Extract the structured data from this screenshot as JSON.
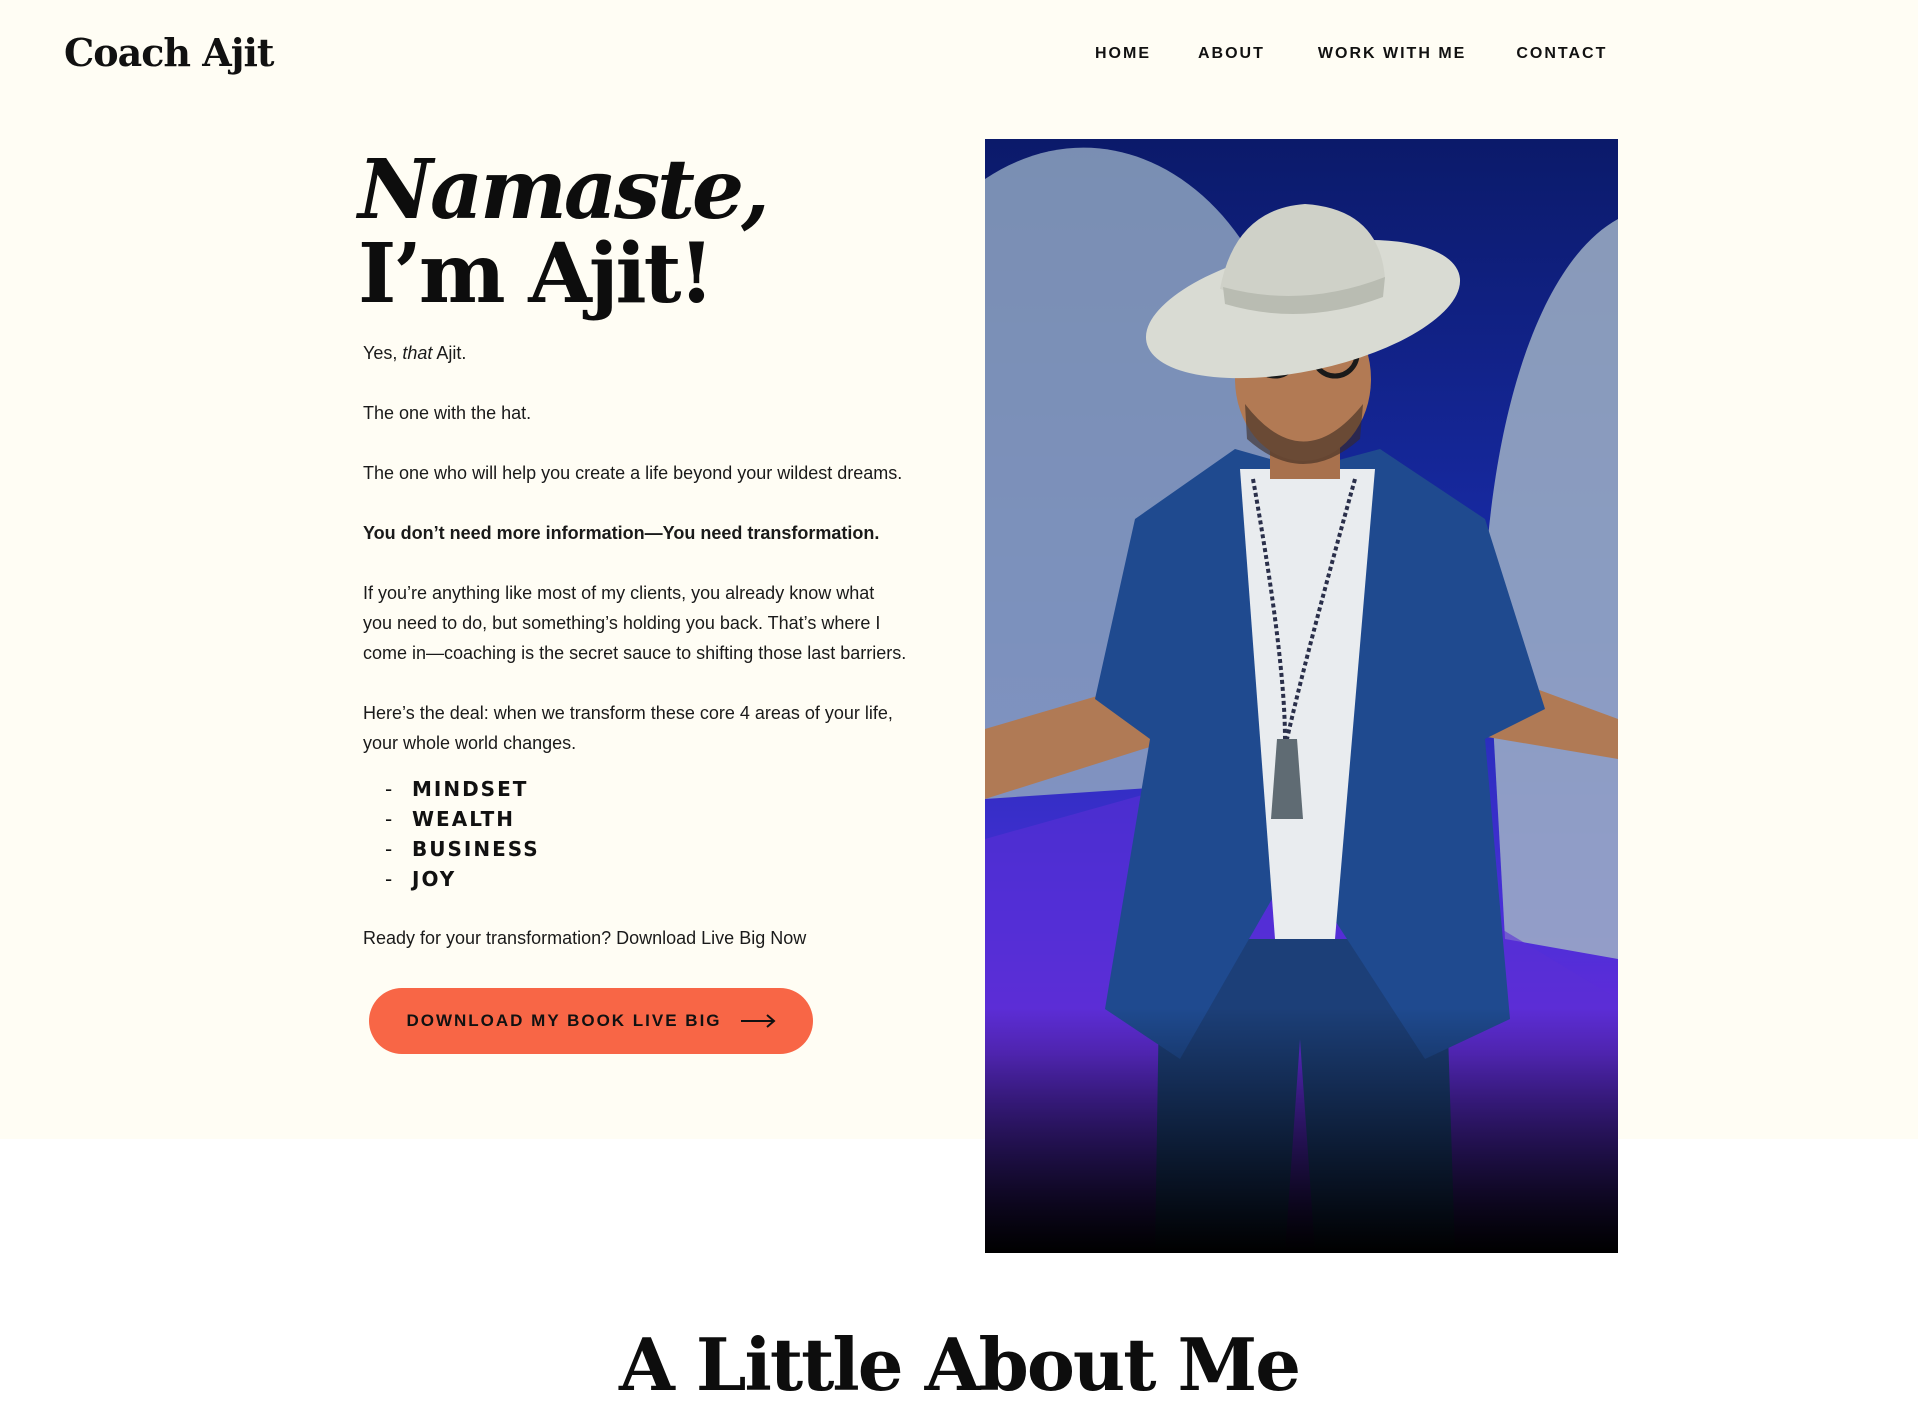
{
  "header": {
    "logo": "Coach Ajit",
    "nav": [
      {
        "label": "HOME"
      },
      {
        "label": "ABOUT"
      },
      {
        "label": "WORK WITH ME"
      },
      {
        "label": "CONTACT"
      }
    ]
  },
  "hero": {
    "title_line1": "Namaste,",
    "title_line2": "I’m Ajit!",
    "p1_prefix": "Yes, ",
    "p1_italic": "that",
    "p1_suffix": " Ajit.",
    "p2": "The one with the hat.",
    "p3": "The one who will help you create a life beyond your wildest dreams.",
    "p4": "You don’t need more information—You need transformation.",
    "p5_line1": "If you’re anything like most of my clients, you already know what",
    "p5_line2": "you need to do, but something’s holding you back. That’s where I",
    "p5_line3": "come in—coaching is the secret sauce to shifting those last barriers.",
    "p6_line1": "Here’s the deal: when we transform these core 4 areas of your life,",
    "p6_line2": "your whole world changes.",
    "pillars": [
      "MINDSET",
      "WEALTH",
      "BUSINESS",
      "JOY"
    ],
    "list_marker": "-",
    "p7": "Ready for your transformation? Download Live Big Now",
    "cta_label": "DOWNLOAD MY BOOK LIVE BIG",
    "cta_icon": "arrow-right-icon",
    "photo_subject": "portrait-photo"
  },
  "about": {
    "title": "A Little About Me"
  },
  "colors": {
    "hero_background": "#fffdf4",
    "cta_background": "#f86646",
    "photo_jacket": "#1f4a8f",
    "photo_stage": "#3b2fd0"
  }
}
